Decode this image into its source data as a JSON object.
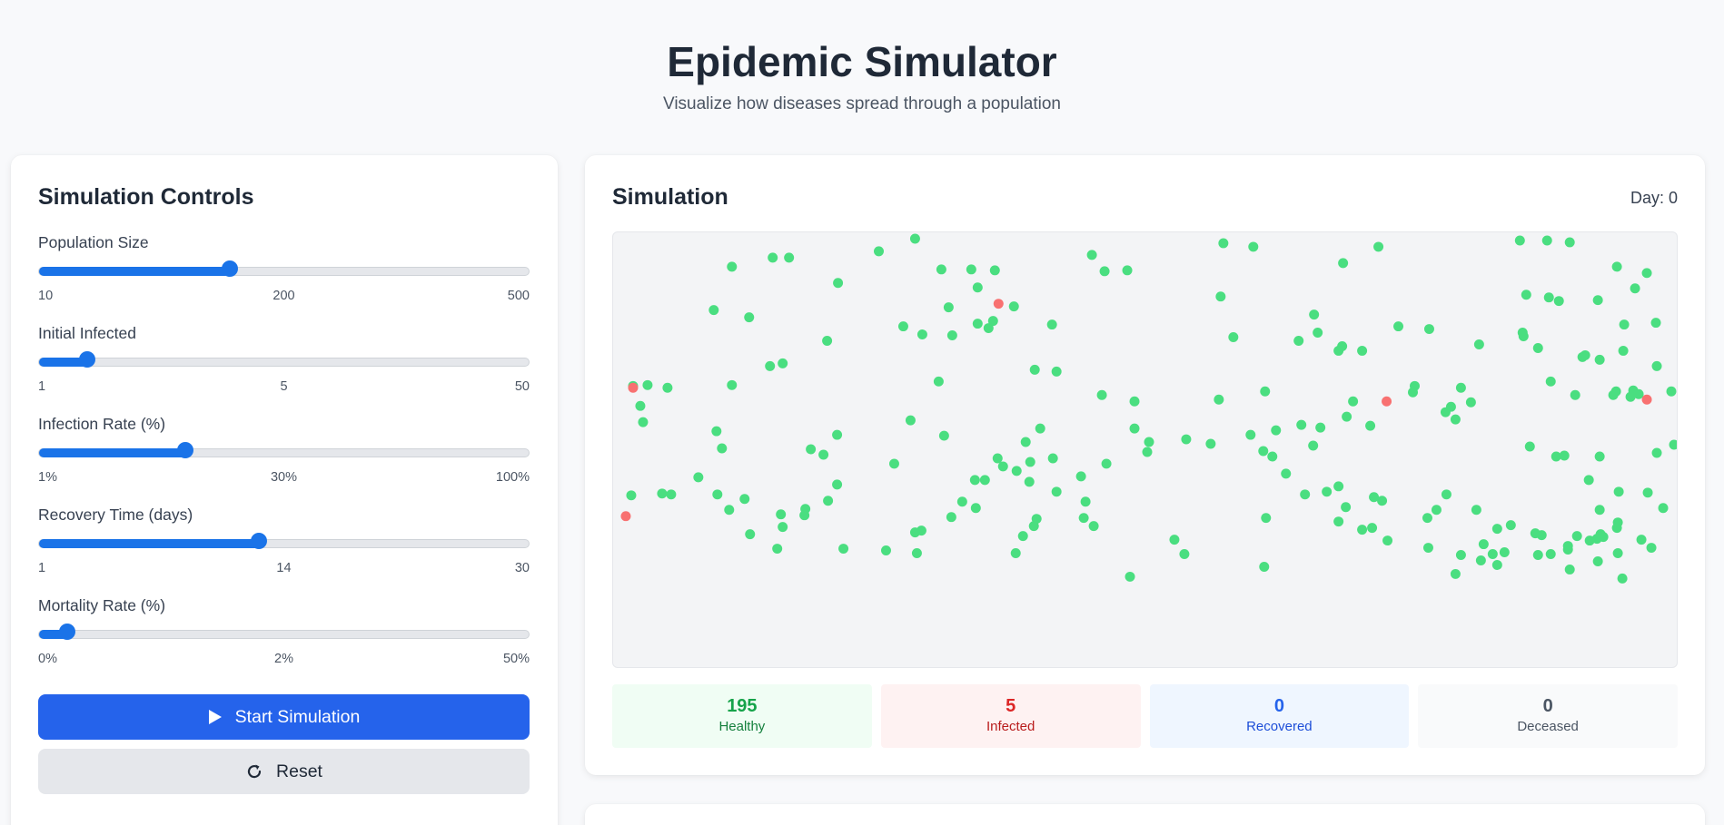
{
  "header": {
    "title": "Epidemic Simulator",
    "subtitle": "Visualize how diseases spread through a population"
  },
  "controls": {
    "title": "Simulation Controls",
    "sliders": [
      {
        "label": "Population Size",
        "min": "10",
        "mid": "200",
        "max": "500",
        "value_fraction": 0.39
      },
      {
        "label": "Initial Infected",
        "min": "1",
        "mid": "5",
        "max": "50",
        "value_fraction": 0.1
      },
      {
        "label": "Infection Rate (%)",
        "min": "1%",
        "mid": "30%",
        "max": "100%",
        "value_fraction": 0.3
      },
      {
        "label": "Recovery Time (days)",
        "min": "1",
        "mid": "14",
        "max": "30",
        "value_fraction": 0.45
      },
      {
        "label": "Mortality Rate (%)",
        "min": "0%",
        "mid": "2%",
        "max": "50%",
        "value_fraction": 0.06
      }
    ],
    "start_label": "Start Simulation",
    "reset_label": "Reset"
  },
  "simulation": {
    "title": "Simulation",
    "day_label": "Day: 0",
    "colors": {
      "healthy": "#4ade80",
      "infected": "#f87171"
    },
    "stats": [
      {
        "value": "195",
        "label": "Healthy"
      },
      {
        "value": "5",
        "label": "Infected"
      },
      {
        "value": "0",
        "label": "Recovered"
      },
      {
        "value": "0",
        "label": "Deceased"
      }
    ]
  }
}
